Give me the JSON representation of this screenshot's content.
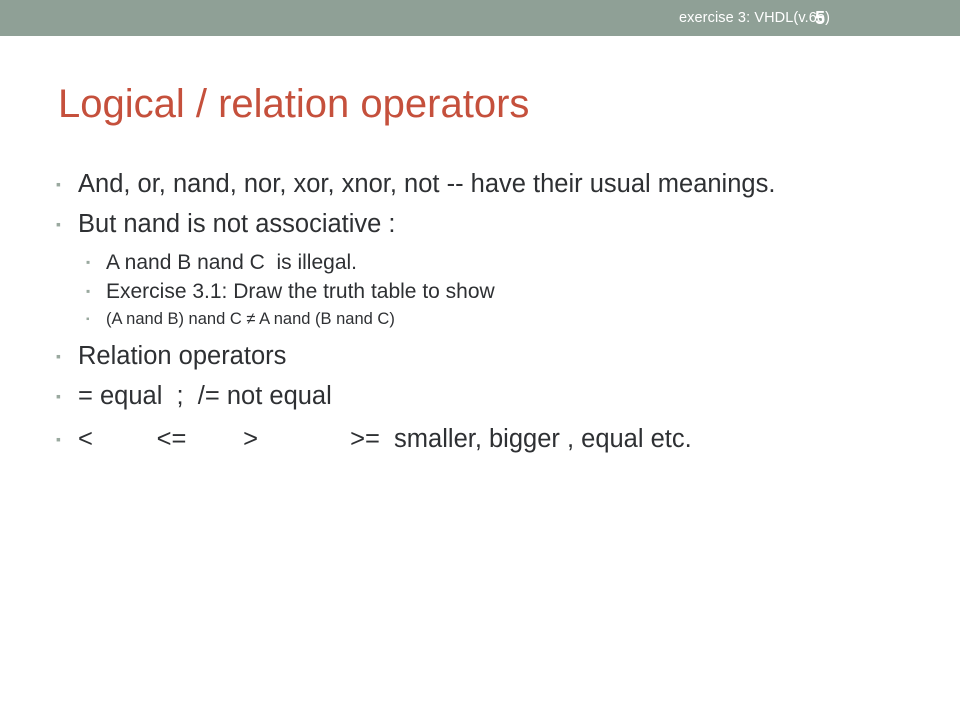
{
  "header": {
    "title": "exercise 3: VHDL(v.6e)",
    "page_number": "5",
    "bar_color": "#8fa096",
    "text_color": "#ffffff"
  },
  "slide": {
    "title": "Logical / relation operators",
    "title_color": "#c5503c",
    "background_color": "#ffffff",
    "body_text_color": "#2e3033",
    "bullet_marker_color": "#9aa99f",
    "bullet_glyph": "▪"
  },
  "body": {
    "items": [
      {
        "level": 1,
        "text": "And, or, nand, nor, xor, xnor, not -- have their usual meanings."
      },
      {
        "level": 1,
        "text": "But nand is not associative :"
      },
      {
        "level": 2,
        "text": "A nand B nand C  is illegal."
      },
      {
        "level": 2,
        "text": "Exercise 3.1: Draw the truth table to show"
      },
      {
        "level": 3,
        "text": "(A nand B) nand C ≠ A nand (B nand C)"
      },
      {
        "level": 1,
        "text": "Relation operators"
      },
      {
        "level": 1,
        "text": "= equal  ;  /= not equal"
      },
      {
        "level": 1,
        "text": "<         <=        >             >=  smaller, bigger , equal etc."
      }
    ]
  }
}
